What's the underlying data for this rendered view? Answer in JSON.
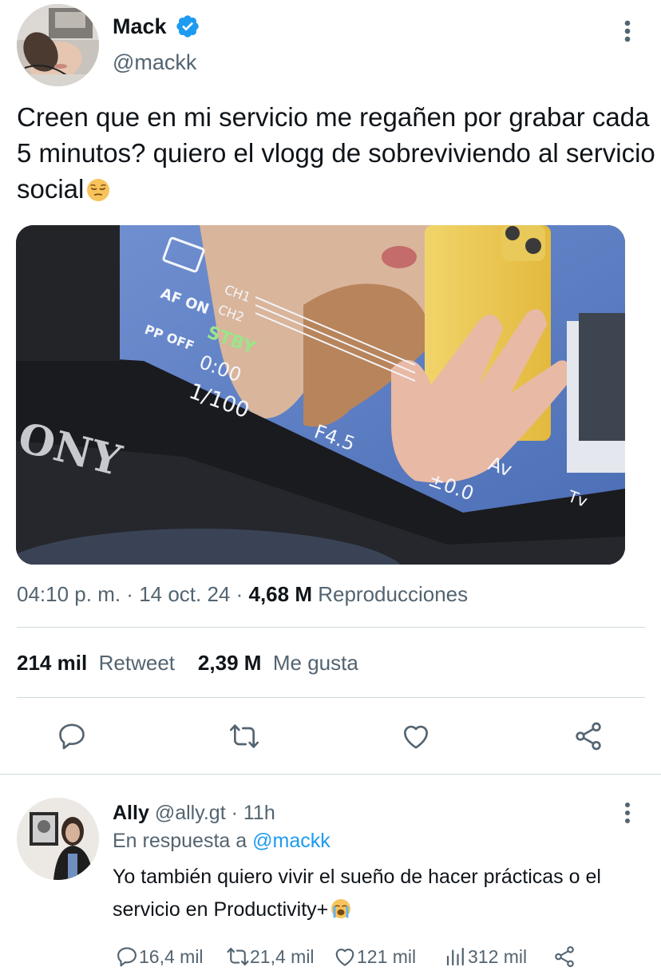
{
  "tweet": {
    "author": {
      "name": "Mack",
      "handle": "@mackk",
      "verified": true,
      "avatar": "profile-photo"
    },
    "text": "Creen que en mi servicio me regañen por grabar cada 5 minutos? quiero el vlogg de sobreviviendo al servicio social",
    "emoji": "pensive-face",
    "media": {
      "type": "photo",
      "overlay_text": {
        "af_on": "AF ON",
        "pp_off": "PP OFF",
        "ch1": "CH1",
        "ch2": "CH2",
        "stby": "STBY",
        "timecode": "0:00",
        "shutter": "1/100",
        "aperture": "F4.5",
        "exposure": "±0.0",
        "mode_av": "Av",
        "mode_tv": "Tv",
        "brand": "ONY"
      }
    },
    "time": "04:10 p. m.",
    "date": "14 oct. 24",
    "views_count": "4,68 M",
    "views_label": "Reproducciones",
    "retweets_count": "214 mil",
    "retweets_label": "Retweet",
    "likes_count": "2,39 M",
    "likes_label": "Me gusta",
    "actions": [
      "reply-icon",
      "retweet-icon",
      "like-icon",
      "share-icon"
    ]
  },
  "reply": {
    "author": {
      "name": "Ally",
      "handle": "@ally.gt",
      "avatar": "profile-photo"
    },
    "time_ago": "11h",
    "replying_to_label": "En respuesta a",
    "replying_to_handle": "@mackk",
    "text": "Yo también quiero vivir el sueño de hacer prácticas o el servicio en Productivity+",
    "emoji": "loudly-crying-face",
    "stats": {
      "replies": "16,4 mil",
      "retweets": "21,4 mil",
      "likes": "121 mil",
      "views": "312 mil"
    }
  },
  "colors": {
    "text": "#0f1419",
    "secondary": "#536471",
    "accent": "#1d9bf0",
    "divider": "#cfd9de"
  }
}
